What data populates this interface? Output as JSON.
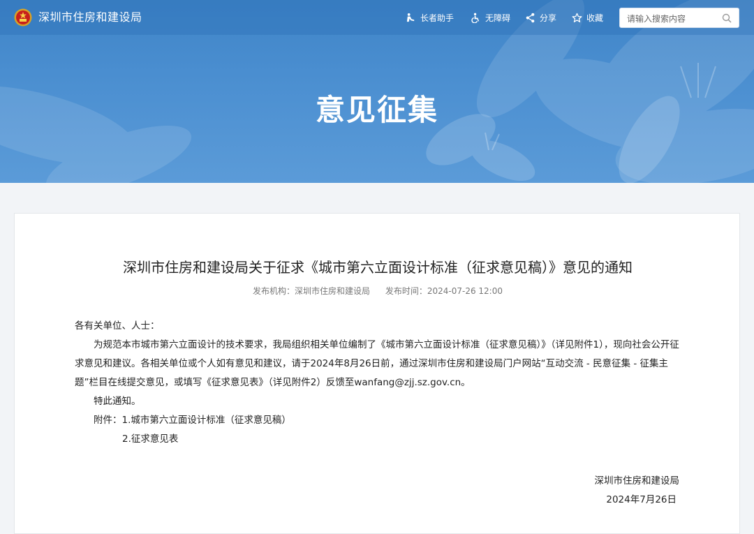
{
  "header": {
    "site_name": "深圳市住房和建设局",
    "tools": [
      {
        "label": "长者助手",
        "icon": "elderly-helper-icon"
      },
      {
        "label": "无障碍",
        "icon": "accessibility-icon"
      },
      {
        "label": "分享",
        "icon": "share-icon"
      },
      {
        "label": "收藏",
        "icon": "star-icon"
      }
    ],
    "search": {
      "placeholder": "请输入搜索内容"
    }
  },
  "banner": {
    "title": "意见征集"
  },
  "article": {
    "title": "深圳市住房和建设局关于征求《城市第六立面设计标准（征求意见稿）》意见的通知",
    "meta": {
      "publisher_label": "发布机构：",
      "publisher": "深圳市住房和建设局",
      "time_label": "发布时间：",
      "time": "2024-07-26 12:00"
    },
    "salutation": "各有关单位、人士：",
    "paragraph": "为规范本市城市第六立面设计的技术要求，我局组织相关单位编制了《城市第六立面设计标准（征求意见稿）》（详见附件1），现向社会公开征求意见和建议。各相关单位或个人如有意见和建议，请于2024年8月26日前，通过深圳市住房和建设局门户网站“互动交流 - 民意征集 - 征集主题”栏目在线提交意见，或填写《征求意见表》（详见附件2）反馈至wanfang@zjj.sz.gov.cn。",
    "notice": "特此通知。",
    "attachments_label": "附件：",
    "attachments": [
      "1.城市第六立面设计标准（征求意见稿）",
      "2.征求意见表"
    ],
    "signature": "深圳市住房和建设局",
    "date": "2024年7月26日"
  },
  "colors": {
    "banner": "#4a8ed0",
    "card": "#ffffff",
    "page_bg": "#f2f4f7"
  }
}
